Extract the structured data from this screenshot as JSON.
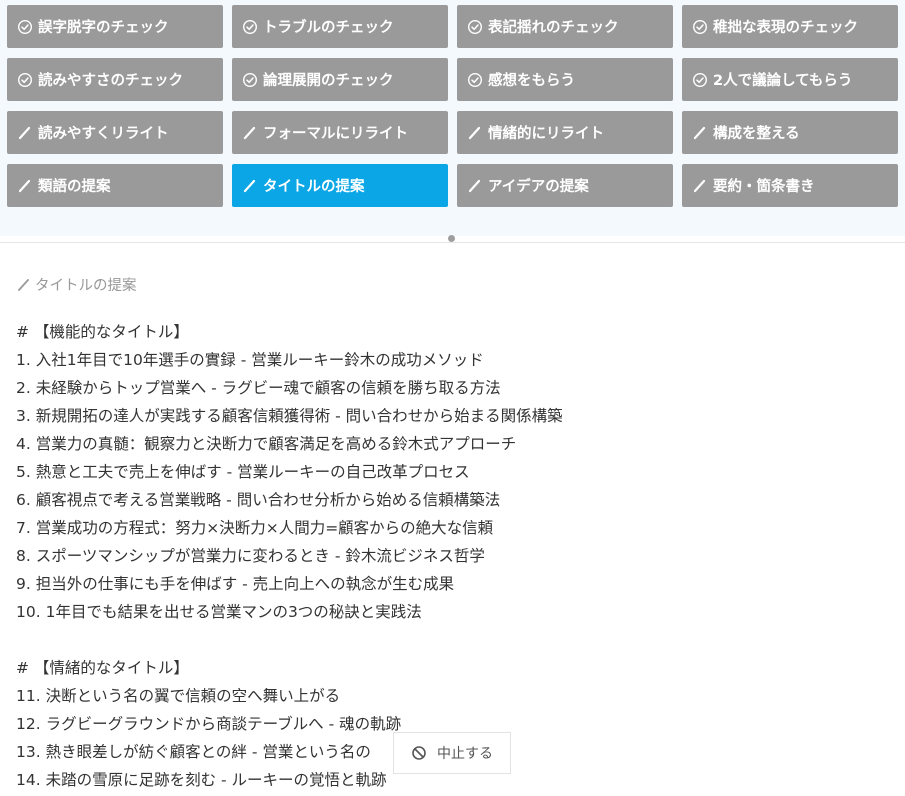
{
  "toolbar": {
    "buttons": [
      {
        "label": "誤字脱字のチェック",
        "icon": "check-circle-icon"
      },
      {
        "label": "トラブルのチェック",
        "icon": "check-circle-icon"
      },
      {
        "label": "表記揺れのチェック",
        "icon": "check-circle-icon"
      },
      {
        "label": "稚拙な表現のチェック",
        "icon": "check-circle-icon"
      },
      {
        "label": "読みやすさのチェック",
        "icon": "check-circle-icon"
      },
      {
        "label": "論理展開のチェック",
        "icon": "check-circle-icon"
      },
      {
        "label": "感想をもらう",
        "icon": "check-circle-icon"
      },
      {
        "label": "2人で議論してもらう",
        "icon": "check-circle-icon"
      },
      {
        "label": "読みやすくリライト",
        "icon": "pen-icon"
      },
      {
        "label": "フォーマルにリライト",
        "icon": "pen-icon"
      },
      {
        "label": "情緒的にリライト",
        "icon": "pen-icon"
      },
      {
        "label": "構成を整える",
        "icon": "pen-icon"
      },
      {
        "label": "類語の提案",
        "icon": "pen-icon"
      },
      {
        "label": "タイトルの提案",
        "icon": "pen-icon",
        "active": true
      },
      {
        "label": "アイデアの提案",
        "icon": "pen-icon"
      },
      {
        "label": "要約・箇条書き",
        "icon": "pen-icon"
      }
    ],
    "active_color": "#0aa6e6",
    "button_color": "#9a9a9a"
  },
  "output": {
    "label": "タイトルの提案",
    "lines": [
      "# 【機能的なタイトル】",
      "1. 入社1年目で10年選手の實録 - 営業ルーキー鈴木の成功メソッド",
      "2. 未経験からトップ営業へ - ラグビー魂で顧客の信頼を勝ち取る方法",
      "3. 新規開拓の達人が実践する顧客信頼獲得術 - 問い合わせから始まる関係構築",
      "4. 営業力の真髄：観察力と決断力で顧客満足を高める鈴木式アプローチ",
      "5. 熱意と工夫で売上を伸ばす - 営業ルーキーの自己改革プロセス",
      "6. 顧客視点で考える営業戦略 - 問い合わせ分析から始める信頼構築法",
      "7. 営業成功の方程式：努力×決断力×人間力=顧客からの絶大な信頼",
      "8. スポーツマンシップが営業力に変わるとき - 鈴木流ビジネス哲学",
      "9. 担当外の仕事にも手を伸ばす - 売上向上への執念が生む成果",
      "10. 1年目でも結果を出せる営業マンの3つの秘訣と実践法",
      "",
      "# 【情緒的なタイトル】",
      "11. 決断という名の翼で信頼の空へ舞い上がる",
      "12. ラグビーグラウンドから商談テーブルへ - 魂の軌跡",
      "13. 熱き眼差しが紡ぐ顧客との絆 - 営業という名の",
      "14. 未踏の雪原に足跡を刻む - ルーキーの覚悟と軌跡"
    ]
  },
  "stop_button": {
    "label": "中止する",
    "icon": "prohibit-icon"
  }
}
